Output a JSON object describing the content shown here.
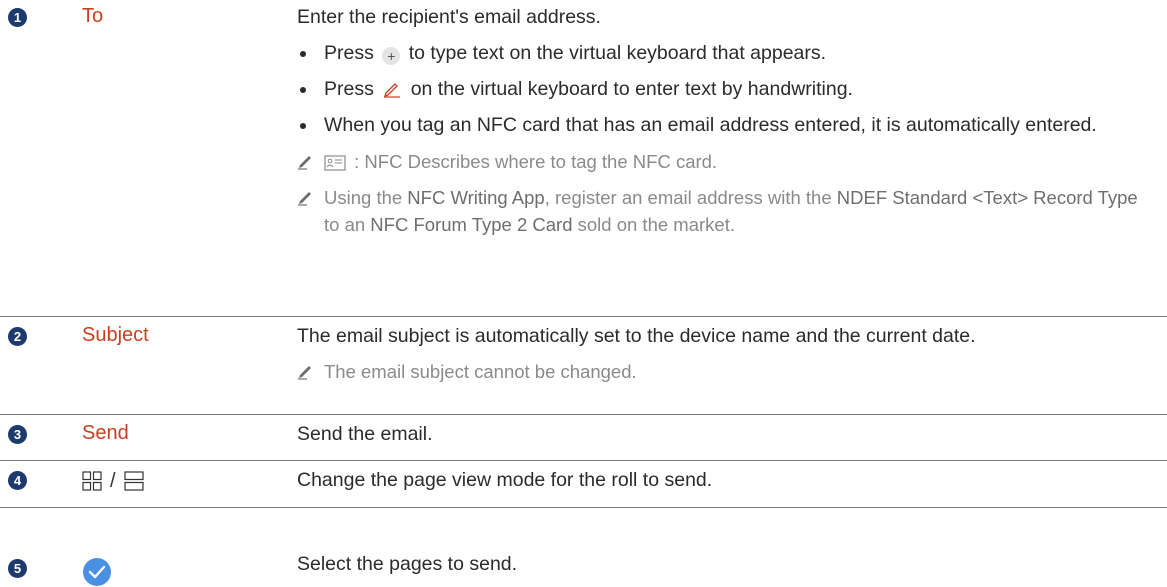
{
  "rows": [
    {
      "number": "1",
      "label": "To",
      "description": "Enter the recipient's email address.",
      "bullets": [
        {
          "before": "Press",
          "icon": "plus-icon",
          "after": "to type text on the virtual keyboard that appears."
        },
        {
          "before": "Press",
          "icon": "pen-icon",
          "after": "on the virtual keyboard to enter text by handwriting."
        },
        {
          "text": "When you tag an NFC card that has an email address entered, it is automatically entered."
        }
      ],
      "notes": [
        {
          "icon": "nfc-card-icon",
          "text": ": NFC Describes where to tag the NFC card."
        },
        {
          "parts": [
            "Using the ",
            "NFC Writing App",
            ", register an email address with the ",
            "NDEF Standard <Text> Record Type",
            " to an ",
            "NFC Forum Type 2 Card",
            " sold on the market."
          ]
        }
      ]
    },
    {
      "number": "2",
      "label": "Subject",
      "description": "The email subject is automatically set to the device name and the current date.",
      "notes": [
        {
          "text": "The email subject cannot be changed."
        }
      ]
    },
    {
      "number": "3",
      "label": "Send",
      "description": "Send the email."
    },
    {
      "number": "4",
      "label_separator": "/",
      "label_icons": [
        "grid-view-icon",
        "list-view-icon"
      ],
      "description": "Change the page view mode for the roll to send."
    },
    {
      "number": "5",
      "label_icon": "check-circle-icon",
      "description": "Select the pages to send."
    }
  ],
  "colors": {
    "label": "#c8401f",
    "number_bg": "#1c3a6b",
    "check": "#4a90e2"
  }
}
